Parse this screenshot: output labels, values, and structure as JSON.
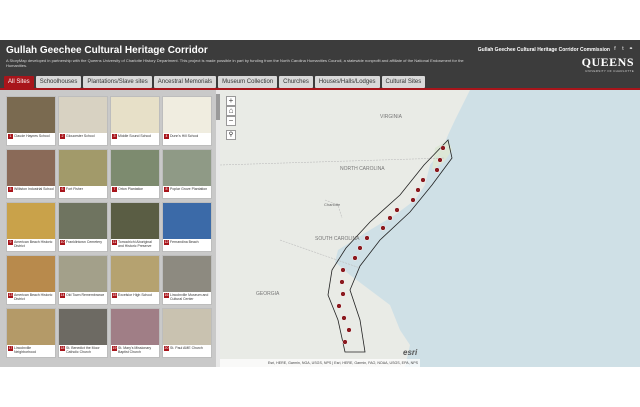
{
  "header": {
    "title": "Gullah Geechee Cultural Heritage Corridor",
    "description": "A StoryMap developed in partnership with the Queens University of Charlotte History Department. This project is made possible in part by funding from the North Carolina Humanities Council, a statewide nonprofit and affiliate of the National Endowment for the Humanities.",
    "commission": "Gullah Geechee Cultural Heritage Corridor Commission",
    "logo": "QUEENS",
    "logo_sub": "UNIVERSITY OF CHARLOTTE"
  },
  "tabs": [
    "All Sites",
    "Schoolhouses",
    "Plantations/Slave sites",
    "Ancestral Memorials",
    "Museum Collection",
    "Churches",
    "Houses/Halls/Lodges",
    "Cultural Sites"
  ],
  "sites": [
    {
      "num": "1",
      "name": "Claude Haynes School",
      "color": "#7a6a50"
    },
    {
      "num": "2",
      "name": "Gloucester School",
      "color": "#d8d2c2"
    },
    {
      "num": "3",
      "name": "Middle Sound School",
      "color": "#e7e0c8"
    },
    {
      "num": "4",
      "name": "Dunn's Hill School",
      "color": "#f0ede0"
    },
    {
      "num": "5",
      "name": "Williston Industrial School",
      "color": "#8a6a58"
    },
    {
      "num": "6",
      "name": "Fort Fisher",
      "color": "#a29a6a"
    },
    {
      "num": "7",
      "name": "Orton Plantation",
      "color": "#7d8b6f"
    },
    {
      "num": "8",
      "name": "Poplar Grove Plantation",
      "color": "#8f9a86"
    },
    {
      "num": "9",
      "name": "American Beach Historic District",
      "color": "#c9a24a"
    },
    {
      "num": "10",
      "name": "Franklintown Cemetery",
      "color": "#6f7460"
    },
    {
      "num": "11",
      "name": "Tomochichi Aboriginal and Historic Preserve",
      "color": "#5a5d44"
    },
    {
      "num": "12",
      "name": "Fernandina Beach",
      "color": "#3b6aa8"
    },
    {
      "num": "13",
      "name": "American Beach Historic District",
      "color": "#b88a4c"
    },
    {
      "num": "14",
      "name": "Old Town Remembrance",
      "color": "#a3a08a"
    },
    {
      "num": "15",
      "name": "Excelsior High School",
      "color": "#b5a270"
    },
    {
      "num": "16",
      "name": "Lincolnville Museum and Cultural Center",
      "color": "#8d8a80"
    },
    {
      "num": "17",
      "name": "Lincolnville Neighborhood",
      "color": "#b49a68"
    },
    {
      "num": "18",
      "name": "St. Benedict the Moor Catholic Church",
      "color": "#6d6a63"
    },
    {
      "num": "19",
      "name": "St. Mary's Missionary Baptist Church",
      "color": "#a07e86"
    },
    {
      "num": "20",
      "name": "St. Paul AME Church",
      "color": "#c9c2b0"
    }
  ],
  "map": {
    "zoom_in": "+",
    "home": "⌂",
    "zoom_out": "−",
    "search": "⚲",
    "attribution": "Esri, HERE, Garmin, NGA, USGS, NPS | Esri, HERE, Garmin, FAO, NOAA, USGS, EPA, NPS",
    "brand": "esri",
    "labels": {
      "state1": "VIRGINIA",
      "state2": "NORTH CAROLINA",
      "state3": "SOUTH CAROLINA",
      "city": "Charlotte",
      "state4": "GEORGIA"
    }
  },
  "colors": {
    "accent": "#a8151b",
    "header_bg": "#3c3c3c",
    "sidebar_bg": "#c9c9c9"
  }
}
